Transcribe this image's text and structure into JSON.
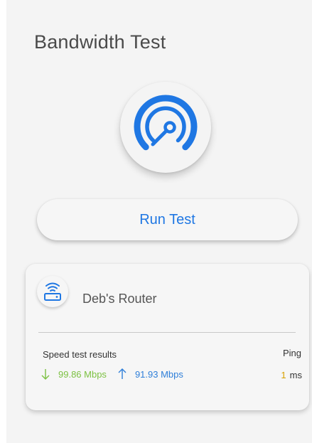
{
  "header": {
    "title": "Bandwidth Test"
  },
  "gauge": {
    "icon": "speedometer-icon",
    "color": "#1f77e3"
  },
  "actions": {
    "run_test_label": "Run Test",
    "accent_color": "#1f77e3"
  },
  "router": {
    "icon": "wifi-router-icon",
    "name": "Deb's Router"
  },
  "results": {
    "heading": "Speed test results",
    "download": {
      "icon": "arrow-down-icon",
      "value": "99.86 Mbps",
      "color": "#7cc142"
    },
    "upload": {
      "icon": "arrow-up-icon",
      "value": "91.93 Mbps",
      "color": "#2f7fd9"
    },
    "ping": {
      "label": "Ping",
      "value": "1",
      "unit": "ms",
      "color": "#d8a000"
    }
  }
}
